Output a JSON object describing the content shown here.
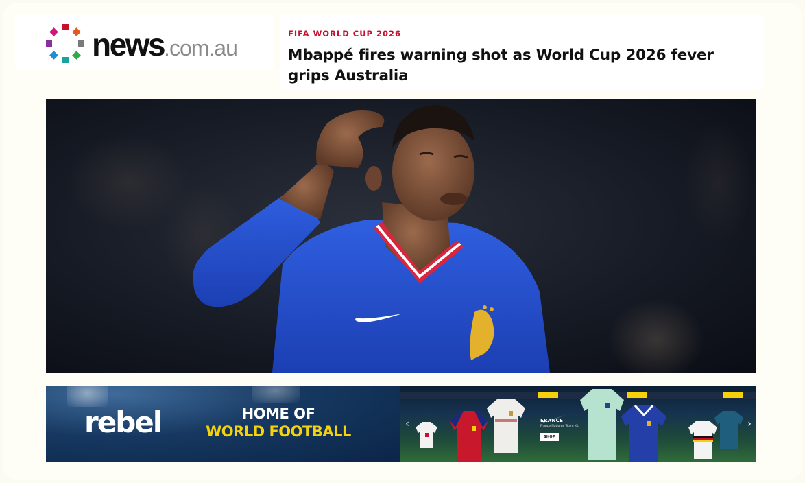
{
  "brand": {
    "logo_word": "news",
    "logo_domain": ".com.au",
    "dot_colors": [
      "#c8102e",
      "#e55a1c",
      "#7a7a7a",
      "#2eab48",
      "#1e8fd6",
      "#8a2f9c",
      "#d1157a",
      "#1aa39c"
    ]
  },
  "article": {
    "kicker": "FIFA WORLD CUP 2026",
    "headline": "Mbappé fires warning shot as World Cup 2026 fever grips Australia",
    "kicker_color": "#c8102e"
  },
  "hero": {
    "subject": "footballer-in-blue-france-kit"
  },
  "ad": {
    "brand": "rebel",
    "tagline_line1": "HOME OF",
    "tagline_line2": "WORLD FOOTBALL",
    "tagline_color": "#f5d20a",
    "kit_country": "FRANCE",
    "kit_subtitle": "France National Team Kit",
    "shop_label": "SHOP",
    "prev_icon": "chevron-left-icon",
    "next_icon": "chevron-right-icon",
    "prev_glyph": "‹",
    "next_glyph": "›"
  }
}
